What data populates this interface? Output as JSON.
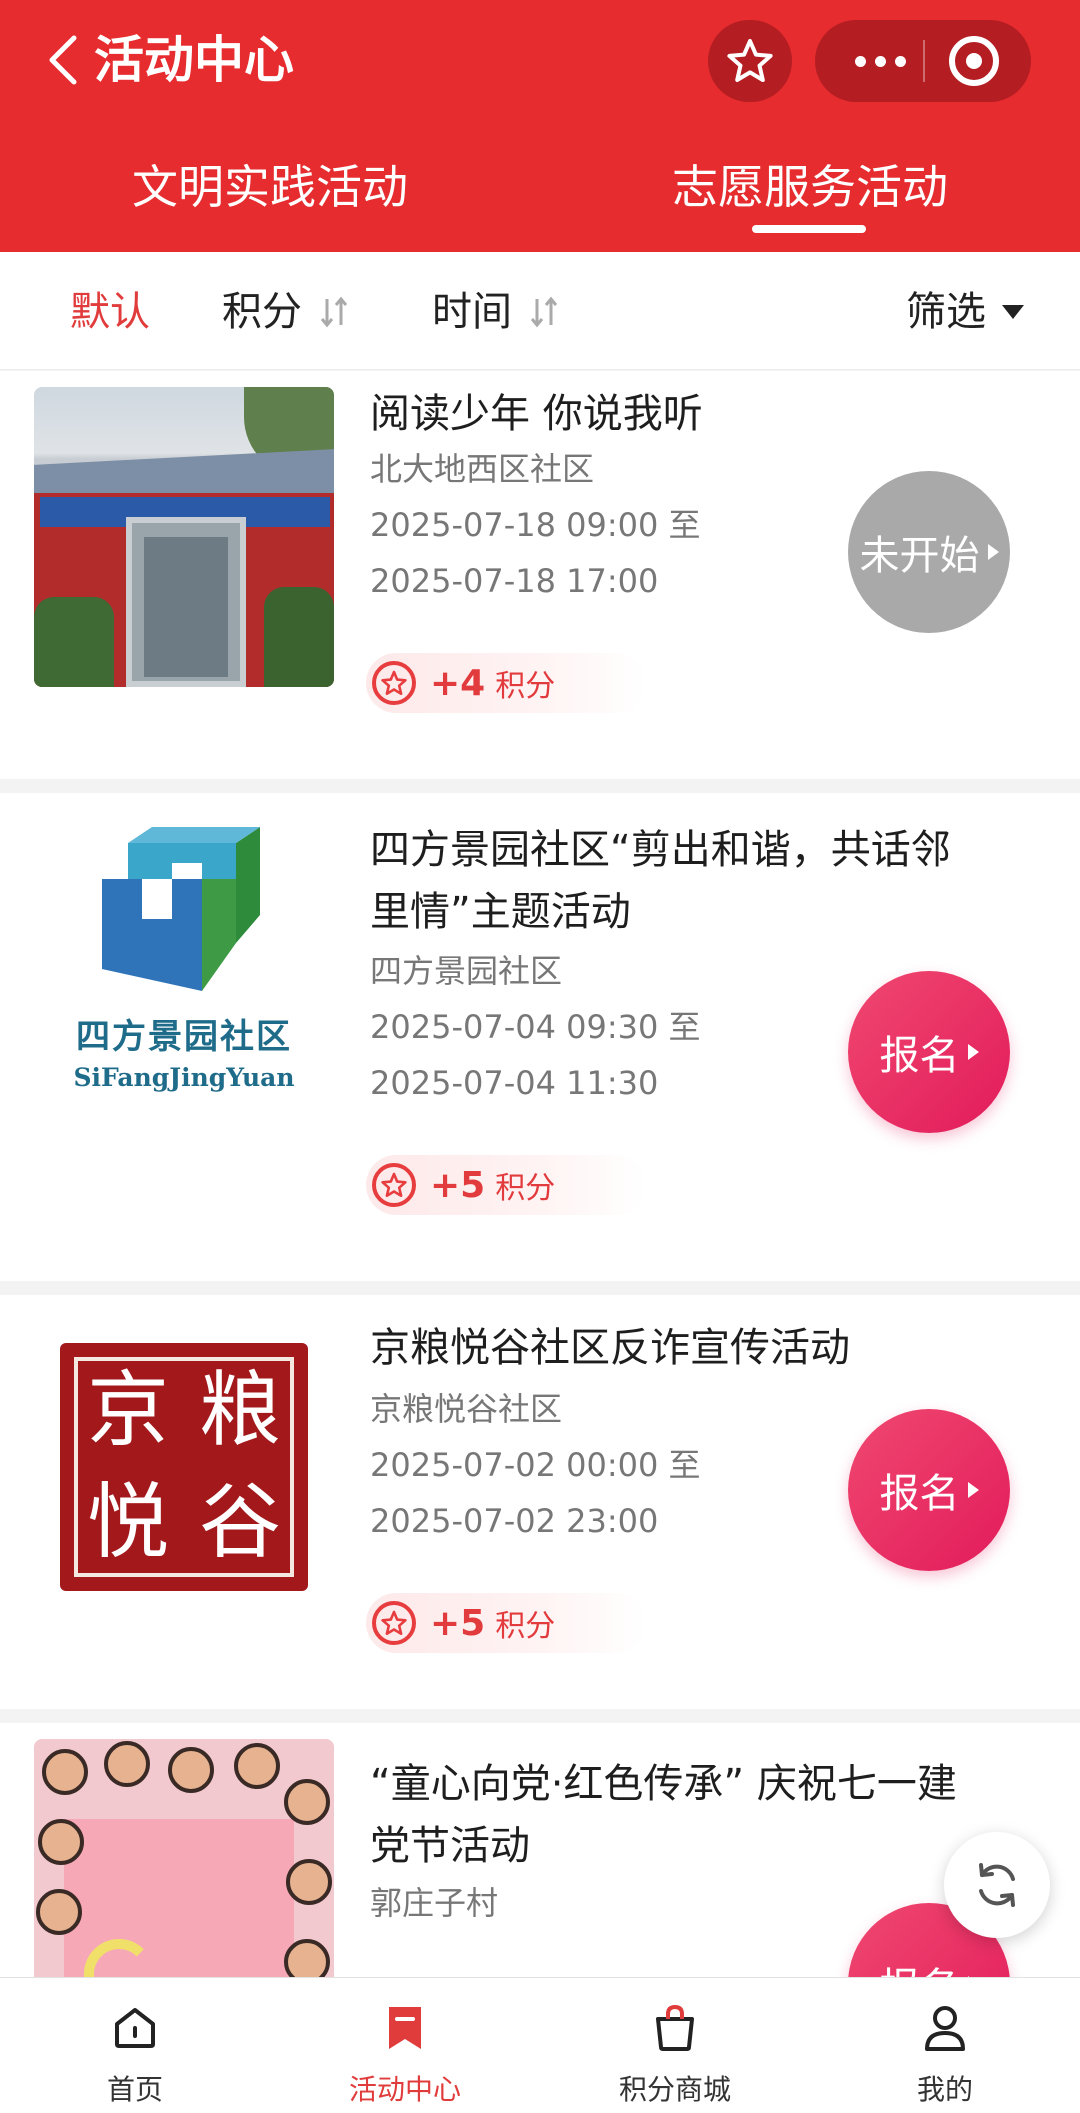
{
  "header": {
    "title": "活动中心",
    "tabs": [
      {
        "label": "文明实践活动"
      },
      {
        "label": "志愿服务活动"
      }
    ],
    "active_tab": 1
  },
  "sort_bar": {
    "default_label": "默认",
    "points_label": "积分",
    "time_label": "时间",
    "filter_label": "筛选"
  },
  "activities": [
    {
      "title": "阅读少年 你说我听",
      "community": "北大地西区社区",
      "start": "2025-07-18 09:00 至",
      "end": "2025-07-18 17:00",
      "points": "+4",
      "points_unit": "积分",
      "action": "未开始",
      "thumb": "community-building-photo"
    },
    {
      "title": "四方景园社区“剪出和谐，共话邻里情”主题活动",
      "community": "四方景园社区",
      "start": "2025-07-04 09:30 至",
      "end": "2025-07-04 11:30",
      "points": "+5",
      "points_unit": "积分",
      "action": "报名",
      "thumb": "sifangjingyuan-logo",
      "logo_cn": "四方景园社区",
      "logo_en": "SiFangJingYuan"
    },
    {
      "title": "京粮悦谷社区反诈宣传活动",
      "community": "京粮悦谷社区",
      "start": "2025-07-02 00:00 至",
      "end": "2025-07-02 23:00",
      "points": "+5",
      "points_unit": "积分",
      "action": "报名",
      "thumb": "jingliang-seal-logo",
      "seal_chars": [
        "京",
        "粮",
        "悦",
        "谷"
      ]
    },
    {
      "title": "“童心向党·红色传承” 庆祝七一建党节活动",
      "community": "郭庄子村",
      "action": "报名",
      "thumb": "children-flag-photo"
    }
  ],
  "tabbar": {
    "items": [
      {
        "label": "首页",
        "icon": "home-icon"
      },
      {
        "label": "活动中心",
        "icon": "bookmark-icon"
      },
      {
        "label": "积分商城",
        "icon": "shopping-bag-icon"
      },
      {
        "label": "我的",
        "icon": "user-icon"
      }
    ],
    "active_index": 1
  },
  "colors": {
    "brand_red": "#e62c2f",
    "action_pink": "#e8285f",
    "action_gray": "#a9a9a9",
    "points_red": "#e23b3d"
  }
}
